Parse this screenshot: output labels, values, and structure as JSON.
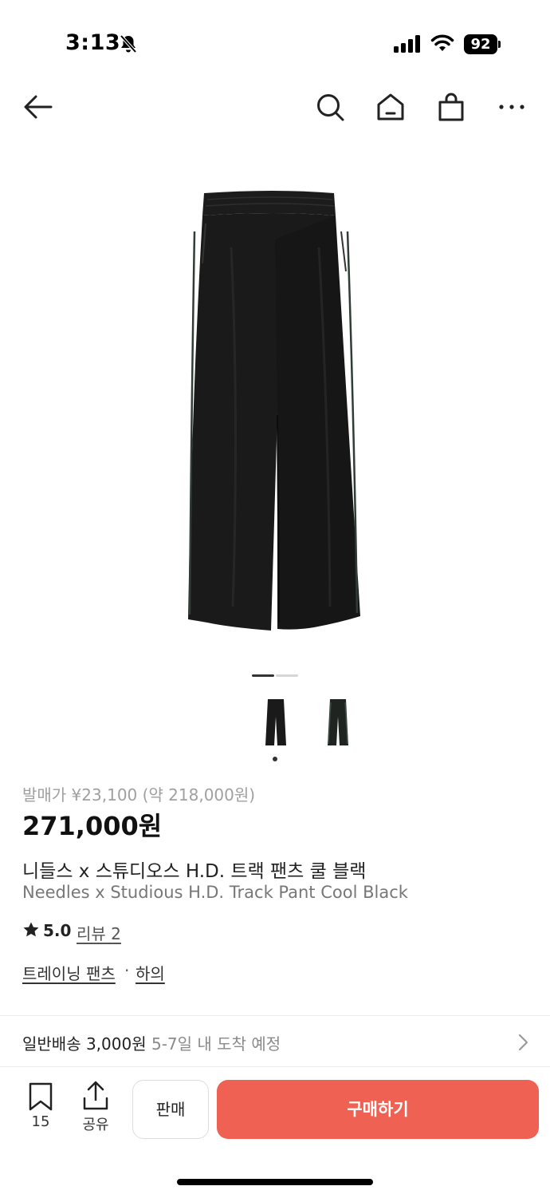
{
  "status_bar": {
    "time": "3:13",
    "battery": "92",
    "icons": [
      "bell-slash-icon",
      "signal-icon",
      "wifi-icon",
      "battery-icon"
    ]
  },
  "nav": {
    "icons": [
      "back-arrow-icon",
      "search-icon",
      "home-icon",
      "shopping-bag-icon",
      "more-icon"
    ]
  },
  "product": {
    "release_price": "발매가 ¥23,100 (약 218,000원)",
    "price": "271,000원",
    "name_ko": "니들스 x 스튜디오스 H.D. 트랙 팬츠 쿨 블랙",
    "name_en": "Needles x Studious H.D. Track Pant Cool Black",
    "rating": "5.0",
    "reviews": "리뷰 2",
    "category_1": "트레이닝 팬츠",
    "category_separator": "·",
    "category_2": "하의",
    "image_count": 2,
    "active_image_index": 0
  },
  "shipping": {
    "label": "일반배송 3,000원",
    "eta": "5-7일 내 도착 예정"
  },
  "bottom_bar": {
    "bookmark_count": "15",
    "share_label": "공유",
    "sell_label": "판매",
    "buy_label": "구매하기"
  },
  "colors": {
    "buy_button": "#ef6253",
    "text_primary": "#222222",
    "text_muted": "#a0a0a0"
  }
}
